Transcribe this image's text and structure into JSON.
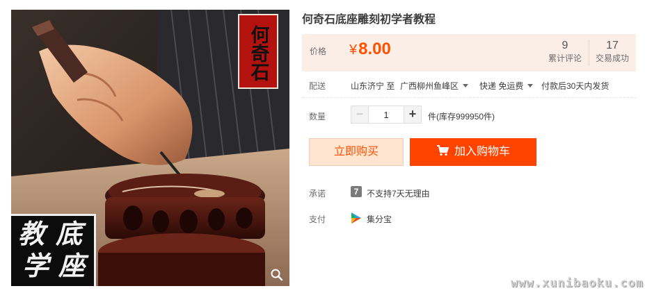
{
  "product": {
    "title": "何奇石底座雕刻初学者教程",
    "image": {
      "stamp_top": "何奇石",
      "stamp_bottom": [
        "教",
        "底",
        "学",
        "座"
      ]
    }
  },
  "price": {
    "label": "价格",
    "currency_symbol": "¥",
    "amount": "8.00",
    "color": "#ff5000"
  },
  "stats": {
    "reviews_count": "9",
    "reviews_label": "累计评论",
    "deals_count": "17",
    "deals_label": "交易成功"
  },
  "shipping": {
    "label": "配送",
    "from": "山东济宁 至",
    "to": "广西柳州鱼峰区",
    "method": "快递 免运费",
    "dispatch": "付款后30天内发货"
  },
  "quantity": {
    "label": "数量",
    "value": "1",
    "minus": "−",
    "plus": "+",
    "stock_text": "件(库存999950件)"
  },
  "actions": {
    "buy_now": "立即购买",
    "add_to_cart": "加入购物车",
    "accent_color": "#ff4400"
  },
  "promise": {
    "label": "承诺",
    "badge": "7",
    "text": "不支持7天无理由"
  },
  "payment": {
    "label": "支付",
    "method": "集分宝"
  },
  "watermark": "www.xunibaoku.com",
  "icons": [
    "zoom-icon",
    "caret-down-icon",
    "cart-icon",
    "seven-day-icon",
    "jifenbao-icon"
  ]
}
